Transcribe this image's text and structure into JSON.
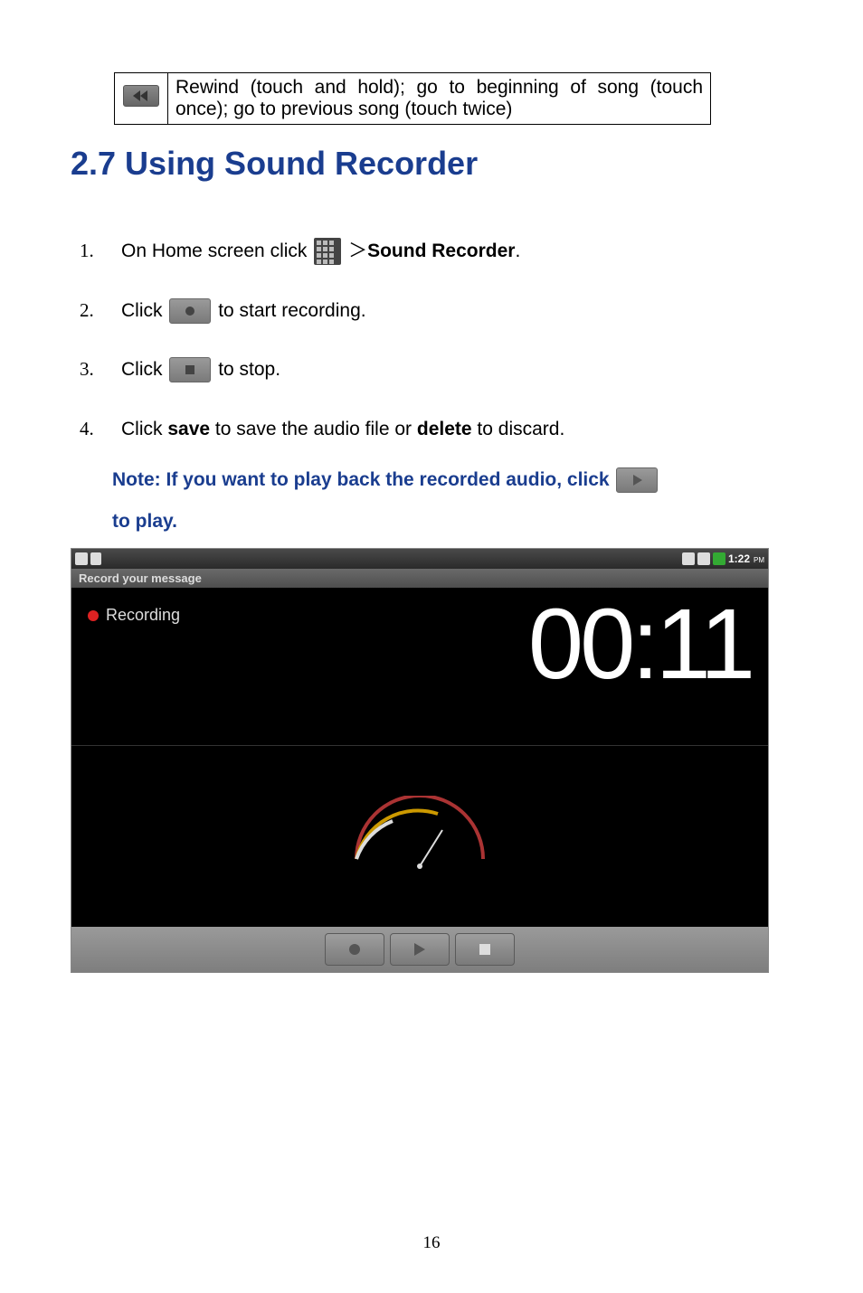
{
  "table": {
    "rewind_desc": "Rewind (touch and hold); go to beginning of song (touch once); go to previous song (touch twice)"
  },
  "section_title": "2.7 Using Sound Recorder",
  "steps": {
    "n1": "1.",
    "s1a": "On Home screen click ",
    "s1b": " ＞",
    "s1c": "Sound Recorder",
    "s1d": ".",
    "n2": "2.",
    "s2a": "Click ",
    "s2b": " to start recording.",
    "n3": "3.",
    "s3a": "Click ",
    "s3b": " to stop.",
    "n4": "4.",
    "s4a": "Click ",
    "s4b": "save",
    "s4c": " to save the audio file or ",
    "s4d": "delete",
    "s4e": " to discard."
  },
  "note": {
    "a": "Note:  If you want to play back the recorded audio, click ",
    "b": " to play."
  },
  "screenshot": {
    "time": "1:22",
    "pm": "PM",
    "title": "Record your message",
    "status": "Recording",
    "timer": "00:11"
  },
  "page_number": "16"
}
